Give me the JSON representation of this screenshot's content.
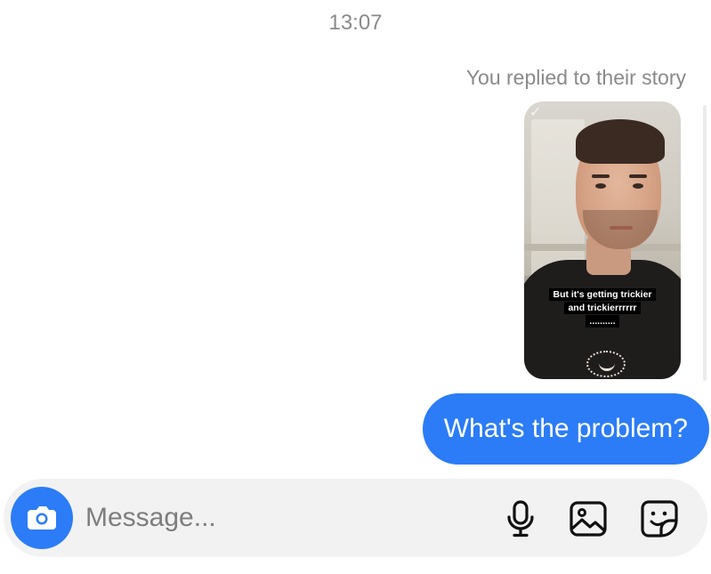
{
  "thread": {
    "timestamp": "13:07",
    "reply_context": "You replied to their story",
    "story": {
      "caption_line1": "But it's getting trickier",
      "caption_line2": "and trickierrrrrr",
      "caption_line3": "..........",
      "verified_mark": "✓"
    },
    "messages": [
      {
        "sender": "me",
        "text": "What's the problem?"
      }
    ]
  },
  "composer": {
    "placeholder": "Message...",
    "value": "",
    "icons": {
      "camera": "camera-icon",
      "mic": "microphone-icon",
      "gallery": "image-icon",
      "sticker": "sticker-icon"
    }
  },
  "colors": {
    "accent": "#2b7cf6",
    "bubble_text": "#ffffff",
    "meta_text": "#8a8a8a",
    "composer_bg": "#f2f2f3"
  }
}
